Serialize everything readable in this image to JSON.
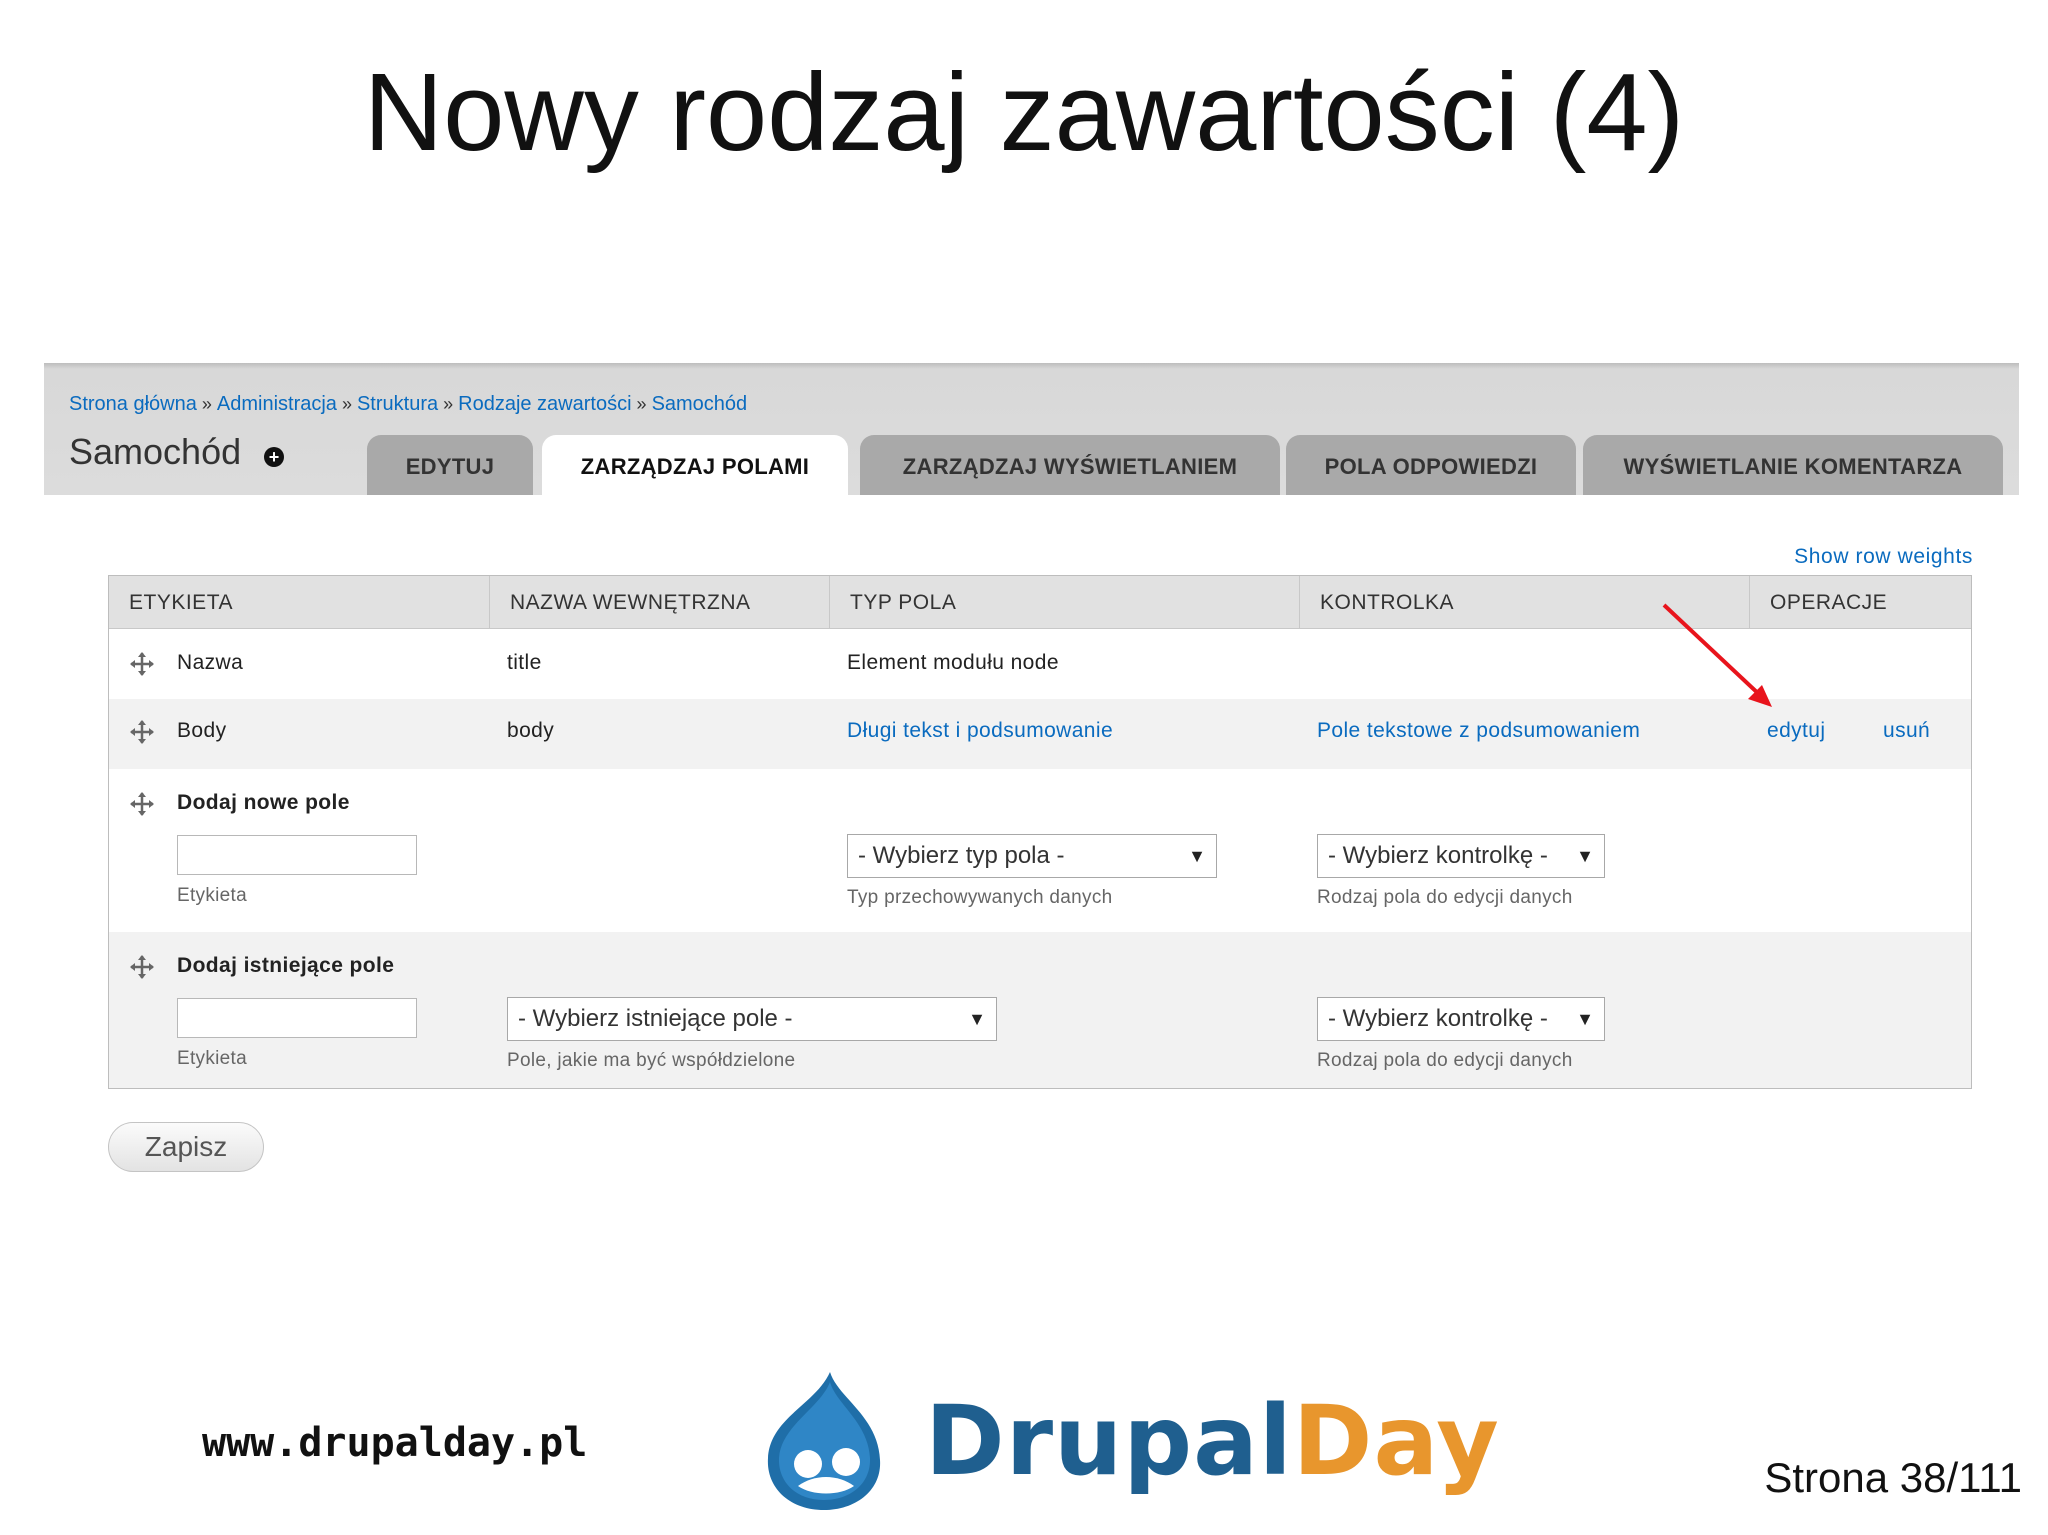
{
  "slide": {
    "title": "Nowy rodzaj zawartości (4)",
    "site_url": "www.drupalday.pl",
    "page_number": "Strona 38/111",
    "logo_part1": "Drupal",
    "logo_part2": "Day",
    "brand_colors": {
      "blue": "#1f5f8f",
      "orange": "#e8962d"
    }
  },
  "breadcrumb": [
    "Strona główna",
    "Administracja",
    "Struktura",
    "Rodzaje zawartości",
    "Samochód"
  ],
  "breadcrumb_separator": "»",
  "node_title": "Samochód",
  "tabs": [
    {
      "label": "EDYTUJ",
      "active": false
    },
    {
      "label": "ZARZĄDZAJ POLAMI",
      "active": true
    },
    {
      "label": "ZARZĄDZAJ WYŚWIETLANIEM",
      "active": false
    },
    {
      "label": "POLA ODPOWIEDZI",
      "active": false
    },
    {
      "label": "WYŚWIETLANIE KOMENTARZA",
      "active": false
    }
  ],
  "show_row_weights": "Show row weights",
  "table": {
    "headers": [
      "ETYKIETA",
      "NAZWA WEWNĘTRZNA",
      "TYP POLA",
      "KONTROLKA",
      "OPERACJE"
    ],
    "rows": [
      {
        "label": "Nazwa",
        "machine_name": "title",
        "field_type": "Element modułu node",
        "widget": "",
        "op_edit": "",
        "op_delete": ""
      },
      {
        "label": "Body",
        "machine_name": "body",
        "field_type": "Długi tekst i podsumowanie",
        "widget": "Pole tekstowe z podsumowaniem",
        "op_edit": "edytuj",
        "op_delete": "usuń"
      }
    ],
    "add_new": {
      "title": "Dodaj nowe pole",
      "label_desc": "Etykieta",
      "type_select": "- Wybierz typ pola -",
      "type_desc": "Typ przechowywanych danych",
      "widget_select": "- Wybierz kontrolkę -",
      "widget_desc": "Rodzaj pola do edycji danych"
    },
    "add_existing": {
      "title": "Dodaj istniejące pole",
      "label_desc": "Etykieta",
      "field_select": "- Wybierz istniejące pole -",
      "field_desc": "Pole, jakie ma być współdzielone",
      "widget_select": "- Wybierz kontrolkę -",
      "widget_desc": "Rodzaj pola do edycji danych"
    }
  },
  "save_button": "Zapisz",
  "annotation_color": "#e8141c"
}
